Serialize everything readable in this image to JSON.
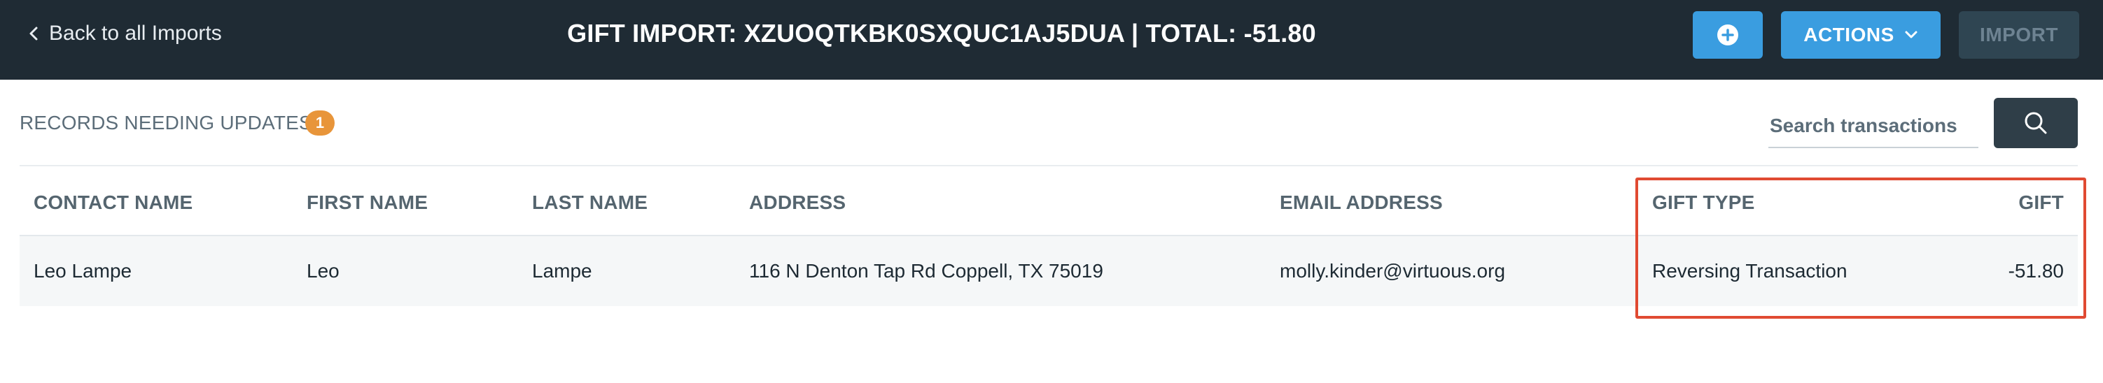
{
  "header": {
    "back_label": "Back to all Imports",
    "title": "GIFT IMPORT: XZUOQTKBK0SXQUC1AJ5DUA | TOTAL: -51.80",
    "add_icon": "plus-circle-icon",
    "actions_label": "ACTIONS",
    "import_label": "IMPORT"
  },
  "records": {
    "label": "RECORDS NEEDING UPDATES",
    "count": "1"
  },
  "search": {
    "placeholder": "Search transactions",
    "icon": "search-icon"
  },
  "table": {
    "columns": [
      "CONTACT NAME",
      "FIRST NAME",
      "LAST NAME",
      "ADDRESS",
      "EMAIL ADDRESS",
      "GIFT TYPE",
      "GIFT"
    ],
    "rows": [
      {
        "contact_name": "Leo Lampe",
        "first_name": "Leo",
        "last_name": "Lampe",
        "address": "116 N Denton Tap Rd Coppell, TX 75019",
        "email": "molly.kinder@virtuous.org",
        "gift_type": "Reversing Transaction",
        "gift": "-51.80"
      }
    ]
  },
  "colors": {
    "header_bg": "#1f2b34",
    "primary_button": "#3a9de0",
    "disabled_button": "#2f4552",
    "badge": "#e8953a",
    "highlight": "#e04a32"
  }
}
